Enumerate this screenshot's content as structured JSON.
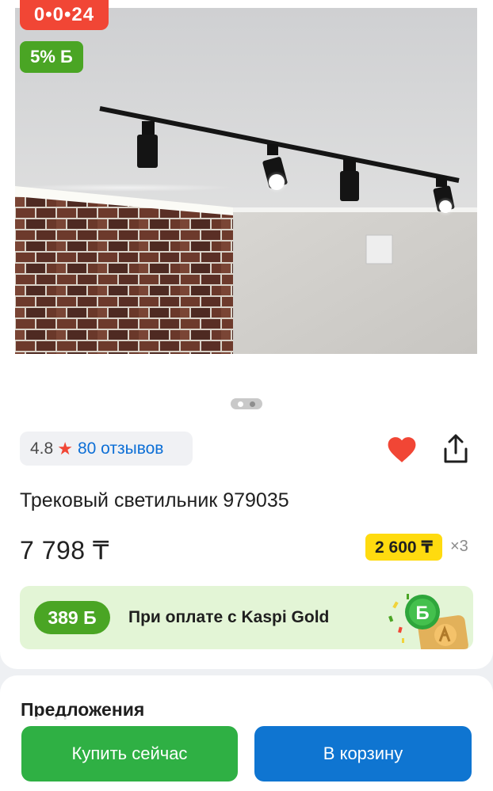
{
  "promo": {
    "timer": "0•0•24",
    "bonus_percent": "5% Б"
  },
  "gallery": {
    "page_count": 2,
    "active_page": 1
  },
  "rating": {
    "value": "4.8",
    "star_icon": "star-icon",
    "reviews_label": "80 отзывов"
  },
  "actions": {
    "favorite_icon": "heart-icon",
    "share_icon": "share-icon"
  },
  "product": {
    "title": "Трековый светильник 979035",
    "price": "7 798 ₸",
    "installment_amount": "2 600 ₸",
    "installment_multiplier": "×3"
  },
  "kaspi_gold": {
    "bonus": "389 Б",
    "text": "При оплате с Kaspi Gold"
  },
  "offers": {
    "title": "Предложения"
  },
  "buttons": {
    "buy_now": "Купить сейчас",
    "add_to_cart": "В корзину"
  },
  "colors": {
    "red": "#f14635",
    "green": "#4aa524",
    "blue": "#0f75d1",
    "buy_green": "#2fb044",
    "yellow": "#ffdb0f"
  }
}
